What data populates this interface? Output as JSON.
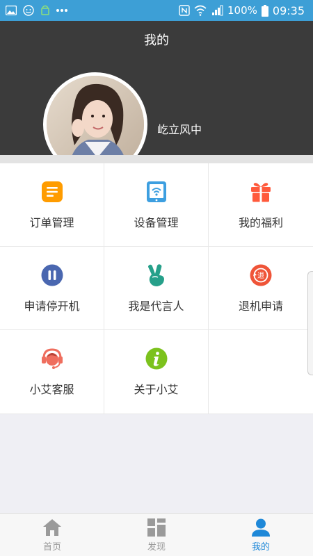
{
  "status_bar": {
    "battery": "100%",
    "time": "09:35",
    "bg_color": "#3d9fd6"
  },
  "header": {
    "title": "我的",
    "username": "屹立风中",
    "bg_color": "#3b3b3b"
  },
  "menu": {
    "items": [
      {
        "label": "订单管理",
        "icon": "order-list-icon",
        "color": "#ff9c00"
      },
      {
        "label": "设备管理",
        "icon": "tablet-wifi-icon",
        "color": "#3d9fe0"
      },
      {
        "label": "我的福利",
        "icon": "gift-icon",
        "color": "#ff5a3c"
      },
      {
        "label": "申请停开机",
        "icon": "pause-icon",
        "color": "#4a67b0"
      },
      {
        "label": "我是代言人",
        "icon": "victory-hand-icon",
        "color": "#26a08a"
      },
      {
        "label": "退机申请",
        "icon": "return-icon",
        "color": "#ef5438"
      },
      {
        "label": "小艾客服",
        "icon": "customer-service-icon",
        "color": "#ef6e5e"
      },
      {
        "label": "关于小艾",
        "icon": "info-icon",
        "color": "#7cc21d"
      }
    ]
  },
  "tabbar": {
    "tabs": [
      {
        "label": "首页",
        "icon": "home-icon",
        "active": false
      },
      {
        "label": "发现",
        "icon": "discover-grid-icon",
        "active": false
      },
      {
        "label": "我的",
        "icon": "profile-icon",
        "active": true
      }
    ],
    "active_color": "#1e88d8",
    "inactive_color": "#999999"
  }
}
